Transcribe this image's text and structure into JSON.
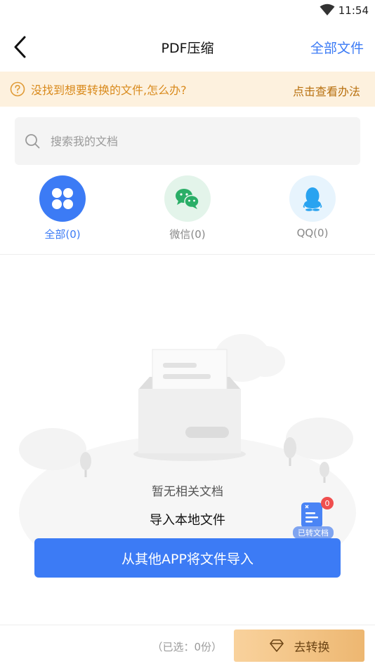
{
  "status_bar": {
    "time": "11:54"
  },
  "nav": {
    "title": "PDF压缩",
    "right_action": "全部文件"
  },
  "notice": {
    "text": "没找到想要转换的文件,怎么办?",
    "link": "点击查看办法"
  },
  "search": {
    "placeholder": "搜索我的文档",
    "value": ""
  },
  "categories": [
    {
      "label": "全部(0)",
      "icon": "all-files-icon",
      "active": true
    },
    {
      "label": "微信(0)",
      "icon": "wechat-icon",
      "active": false
    },
    {
      "label": "QQ(0)",
      "icon": "qq-icon",
      "active": false
    }
  ],
  "empty_state": {
    "message": "暂无相关文档",
    "import_local": "导入本地文件"
  },
  "converted_docs": {
    "label": "已转文档",
    "badge": "0"
  },
  "import_button": {
    "label": "从其他APP将文件导入"
  },
  "bottom_bar": {
    "selected": "（已选：0份）",
    "convert_label": "去转换"
  },
  "colors": {
    "accent": "#3c7bf5",
    "notice_bg": "#fdf1de",
    "notice_text": "#d98a1c",
    "convert_gold": "#edb771",
    "wechat_green": "#2aae67",
    "qq_blue": "#29a3f0"
  }
}
